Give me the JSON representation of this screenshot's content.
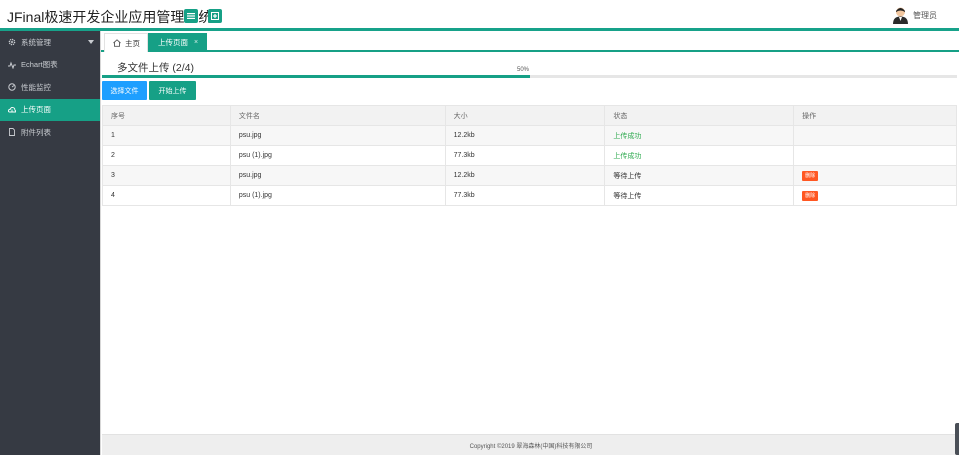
{
  "header": {
    "title": "JFinal极速开发企业应用管理系统",
    "menu_icon": "hamburger-icon",
    "add_icon": "plus-icon",
    "user_name": "管理员",
    "accent_color": "#16a086"
  },
  "sidebar": {
    "items": [
      {
        "label": "系统管理",
        "icon": "gear-icon"
      },
      {
        "label": "Echart图表",
        "icon": "chart-line-icon"
      },
      {
        "label": "性能监控",
        "icon": "gauge-icon"
      },
      {
        "label": "上传页面",
        "icon": "cloud-upload-icon"
      },
      {
        "label": "附件列表",
        "icon": "file-icon"
      }
    ],
    "active_index": 3
  },
  "tabs": [
    {
      "label": "主页",
      "icon": "home-icon"
    },
    {
      "label": "上传页面",
      "close": "×"
    }
  ],
  "upload": {
    "title": "多文件上传 (2/4)",
    "progress_label": "50%",
    "progress_percent": 50,
    "select_label": "选择文件",
    "start_label": "开始上传"
  },
  "table": {
    "headers": [
      "序号",
      "文件名",
      "大小",
      "状态",
      "操作"
    ],
    "rows": [
      {
        "no": "1",
        "name": "psu.jpg",
        "size": "12.2kb",
        "status": "上传成功",
        "action": ""
      },
      {
        "no": "2",
        "name": "psu (1).jpg",
        "size": "77.3kb",
        "status": "上传成功",
        "action": ""
      },
      {
        "no": "3",
        "name": "psu.jpg",
        "size": "12.2kb",
        "status": "等待上传",
        "action": "删除"
      },
      {
        "no": "4",
        "name": "psu (1).jpg",
        "size": "77.3kb",
        "status": "等待上传",
        "action": "删除"
      }
    ]
  },
  "footer": {
    "text": "Copyright ©2019 翠海森林(中国)科技有限公司"
  }
}
